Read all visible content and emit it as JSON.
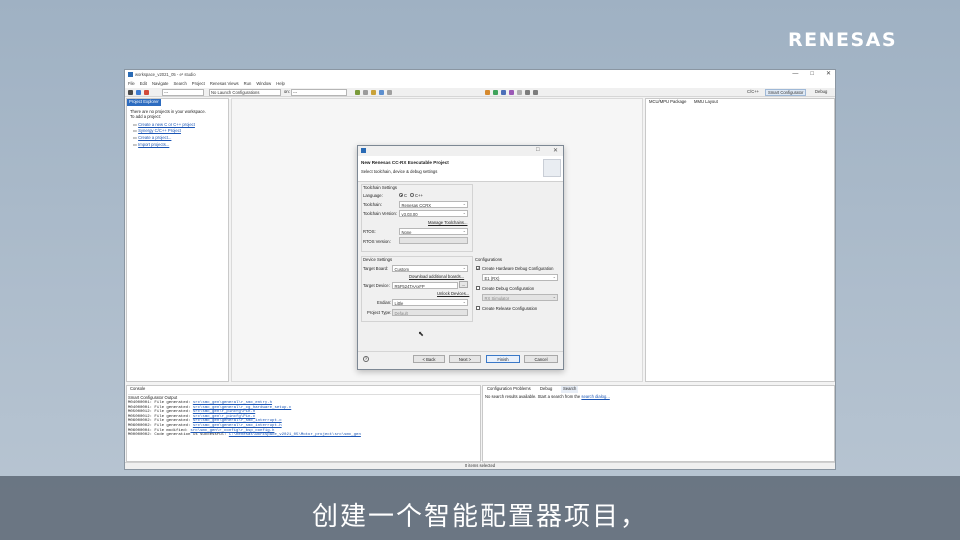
{
  "brand": {
    "logo_text": "RENESAS"
  },
  "window": {
    "title": "workspace_v2021_05 - e² studio",
    "controls": [
      "—",
      "□",
      "✕"
    ]
  },
  "menubar": [
    "File",
    "Edit",
    "Navigate",
    "Search",
    "Project",
    "Renesas Views",
    "Run",
    "Window",
    "Help"
  ],
  "toolbar": {
    "mode_combo": "---",
    "launch_combo": "No Launch Configurations",
    "on_label": "on:",
    "target_combo": "---",
    "perspectives": [
      "C/C++",
      "Smart Configurator",
      "Debug"
    ]
  },
  "project_explorer": {
    "tab": "Project Explorer",
    "message1": "There are no projects in your workspace.",
    "message2": "To add a project:",
    "links": [
      "Create a new C or C++ project",
      "Synergy C/C++ Project",
      "Create a project...",
      "Import projects..."
    ]
  },
  "right_panel": {
    "tabs": [
      "MCU/MPU Package",
      "MMU Layout"
    ]
  },
  "console": {
    "tab": "Console",
    "subtitle": "Smart Configurator Output",
    "lines": [
      {
        "code": "M04000001: File generated:",
        "path": "src\\smc_gen\\general\\r_smc_entry.h"
      },
      {
        "code": "M04000001: File generated:",
        "path": "src\\smc_gen\\general\\r_cg_hardware_setup.c"
      },
      {
        "code": "M05000012: File generated:",
        "path": "src\\smc_gen\\r_pincfg\\Pin.h"
      },
      {
        "code": "M05000012: File generated:",
        "path": "src\\smc_gen\\r_pincfg\\Pin.c"
      },
      {
        "code": "M06000002: File generated:",
        "path": "src\\smc_gen\\general\\r_smc_interrupt.c"
      },
      {
        "code": "M06000002: File generated:",
        "path": "src\\smc_gen\\general\\r_smc_interrupt.h"
      },
      {
        "code": "M06000004: File modified:",
        "path": "src\\smc_gen\\r_config\\r_bsp_config.h"
      },
      {
        "code": "M00000002: Code generation is successful:",
        "path": "C:\\Renesas\\workspace_v2021_05\\Motor_project\\src\\smc_gen"
      }
    ]
  },
  "bottom_right": {
    "tabs": [
      "Configuration Problems",
      "Debug",
      "Search"
    ],
    "message": "No search results available. Start a search from the",
    "link": "search dialog..."
  },
  "statusbar": {
    "text": "0 items selected"
  },
  "dialog": {
    "title": "New Renesas CC-RX Executable Project",
    "subtitle": "Select toolchain, device & debug settings",
    "toolchain_settings": "Toolchain Settings",
    "language_label": "Language:",
    "language_options": [
      "C",
      "C++"
    ],
    "toolchain_label": "Toolchain:",
    "toolchain_value": "Renesas CCRX",
    "toolchain_version_label": "Toolchain Version:",
    "toolchain_version_value": "v3.03.00",
    "manage_toolchains": "Manage Toolchains...",
    "rtos_label": "RTOS:",
    "rtos_value": "None",
    "rtos_version_label": "RTOS Version:",
    "device_settings": "Device Settings",
    "target_board_label": "Target Board:",
    "target_board_value": "Custom",
    "download_boards": "Download additional boards...",
    "target_device_label": "Target Device:",
    "target_device_value": "R5F524TAAxFP",
    "unlock_devices": "Unlock Devices...",
    "endian_label": "Endian:",
    "endian_value": "Little",
    "project_type_label": "Project Type:",
    "project_type_value": "Default",
    "configurations": "Configurations",
    "hw_debug_label": "Create Hardware Debug Configuration",
    "hw_debug_value": "E1 (RX)",
    "debug_label": "Create Debug Configuration",
    "debug_value": "RX Simulator",
    "release_label": "Create Release Configuration",
    "help": "?",
    "buttons": {
      "back": "< Back",
      "next": "Next >",
      "finish": "Finish",
      "cancel": "Cancel"
    }
  },
  "subtitle": "创建一个智能配置器项目，"
}
